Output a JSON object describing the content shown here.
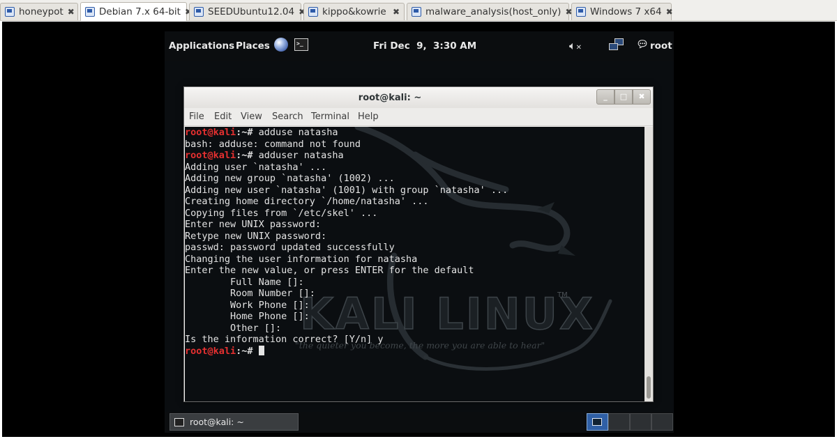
{
  "host_tabs": [
    {
      "label": "honeypot",
      "active": false
    },
    {
      "label": "Debian 7.x 64-bit",
      "active": true
    },
    {
      "label": "SEEDUbuntu12.04",
      "active": false
    },
    {
      "label": "kippo&kowrie",
      "active": false
    },
    {
      "label": "malware_analysis(host_only)",
      "active": false
    },
    {
      "label": "Windows 7 x64",
      "active": false
    }
  ],
  "tab_close_glyph": "✖",
  "top_panel": {
    "applications": "Applications",
    "places": "Places",
    "clock": "Fri Dec  9,  3:30 AM",
    "user": "root",
    "icons": [
      "browser-icon",
      "terminal-icon",
      "volume-muted-icon",
      "network-icon",
      "user-icon"
    ]
  },
  "terminal": {
    "title": "root@kali: ~",
    "window_buttons": {
      "minimize": "_",
      "maximize": "□",
      "close": "✖"
    },
    "menu": [
      "File",
      "Edit",
      "View",
      "Search",
      "Terminal",
      "Help"
    ],
    "prompt_user": "root@kali",
    "prompt_sep": ":~#",
    "lines": [
      {
        "prompt": true,
        "text": " adduse natasha"
      },
      {
        "prompt": false,
        "text": "bash: adduse: command not found"
      },
      {
        "prompt": true,
        "text": " adduser natasha"
      },
      {
        "prompt": false,
        "text": "Adding user `natasha' ..."
      },
      {
        "prompt": false,
        "text": "Adding new group `natasha' (1002) ..."
      },
      {
        "prompt": false,
        "text": "Adding new user `natasha' (1001) with group `natasha' ..."
      },
      {
        "prompt": false,
        "text": "Creating home directory `/home/natasha' ..."
      },
      {
        "prompt": false,
        "text": "Copying files from `/etc/skel' ..."
      },
      {
        "prompt": false,
        "text": "Enter new UNIX password:"
      },
      {
        "prompt": false,
        "text": "Retype new UNIX password:"
      },
      {
        "prompt": false,
        "text": "passwd: password updated successfully"
      },
      {
        "prompt": false,
        "text": "Changing the user information for natasha"
      },
      {
        "prompt": false,
        "text": "Enter the new value, or press ENTER for the default"
      },
      {
        "prompt": false,
        "text": "        Full Name []:"
      },
      {
        "prompt": false,
        "text": "        Room Number []:"
      },
      {
        "prompt": false,
        "text": "        Work Phone []:"
      },
      {
        "prompt": false,
        "text": "        Home Phone []:"
      },
      {
        "prompt": false,
        "text": "        Other []:"
      },
      {
        "prompt": false,
        "text": "Is the information correct? [Y/n] y"
      },
      {
        "prompt": true,
        "text": " ",
        "cursor": true
      }
    ],
    "wallpaper": {
      "wordmark": "KALI LINUX",
      "trademark": "TM",
      "tagline": "\"the quieter you become, the more you are able to hear\""
    }
  },
  "bottom_panel": {
    "taskbar_label": "root@kali: ~",
    "workspaces": 4,
    "active_workspace": 0
  },
  "colors": {
    "prompt_user": "#e53030",
    "terminal_bg": "#0b0e11",
    "terminal_fg": "#e4e4e4",
    "active_workspace": "#2f5fa5"
  }
}
